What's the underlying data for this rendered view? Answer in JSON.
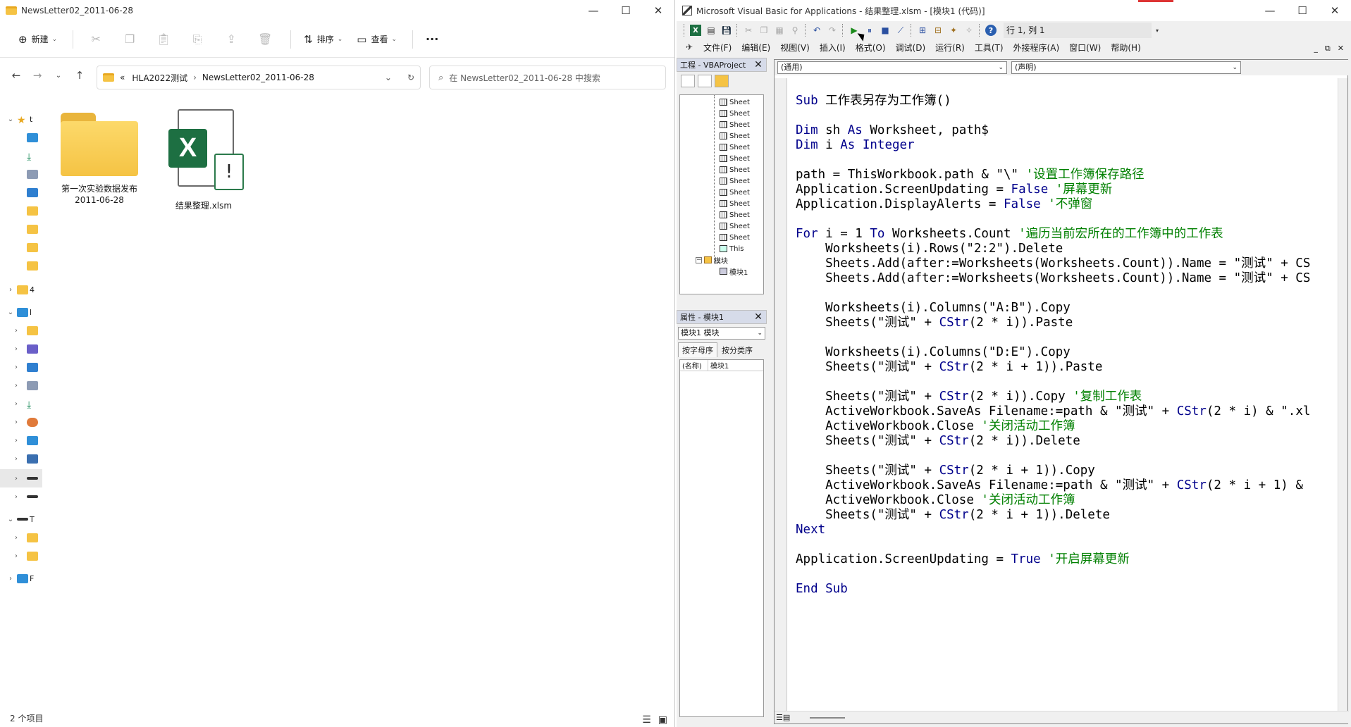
{
  "explorer": {
    "title": "NewsLetter02_2011-06-28",
    "toolbar": {
      "new_label": "新建",
      "sort_label": "排序",
      "view_label": "查看",
      "more_label": "···"
    },
    "address": {
      "prefix": "«",
      "crumbs": [
        "HLA2022测试",
        "NewsLetter02_2011-06-28"
      ]
    },
    "search_placeholder": "在 NewsLetter02_2011-06-28 中搜索",
    "files": [
      {
        "name_line1": "第一次实验数据发布",
        "name_line2": "2011-06-28",
        "type": "folder"
      },
      {
        "name_line1": "结果整理.xlsm",
        "name_line2": "",
        "type": "excel"
      }
    ],
    "status": "2 个项目",
    "sidebar_partial_labels": [
      "t",
      "4",
      "l",
      "T",
      "F"
    ]
  },
  "vba": {
    "title": "Microsoft Visual Basic for Applications - 结果整理.xlsm - [模块1 (代码)]",
    "position": "行 1, 列 1",
    "menus": [
      "文件(F)",
      "编辑(E)",
      "视图(V)",
      "插入(I)",
      "格式(O)",
      "调试(D)",
      "运行(R)",
      "工具(T)",
      "外接程序(A)",
      "窗口(W)",
      "帮助(H)"
    ],
    "project_panel_title": "工程 - VBAProject",
    "tree_sheet_label": "Sheet",
    "tree_this_label": "This",
    "tree_modules_folder": "模块",
    "tree_module1": "模块1",
    "properties_title": "属性 - 模块1",
    "properties_combo": "模块1 模块",
    "properties_tabs": [
      "按字母序",
      "按分类序"
    ],
    "properties_row": {
      "key": "(名称)",
      "value": "模块1"
    },
    "combo_left": "(通用)",
    "combo_right": "(声明)",
    "code": [
      [
        [
          "k",
          "Sub "
        ],
        [
          "n",
          "工作表另存为工作簿()"
        ]
      ],
      [],
      [
        [
          "k",
          "Dim "
        ],
        [
          "n",
          "sh "
        ],
        [
          "k",
          "As "
        ],
        [
          "n",
          "Worksheet, path$"
        ]
      ],
      [
        [
          "k",
          "Dim "
        ],
        [
          "n",
          "i "
        ],
        [
          "k",
          "As Integer"
        ]
      ],
      [],
      [
        [
          "n",
          "path = ThisWorkbook.path & \"\\\" "
        ],
        [
          "c",
          "'设置工作簿保存路径"
        ]
      ],
      [
        [
          "n",
          "Application.ScreenUpdating = "
        ],
        [
          "k",
          "False "
        ],
        [
          "c",
          "'屏幕更新"
        ]
      ],
      [
        [
          "n",
          "Application.DisplayAlerts = "
        ],
        [
          "k",
          "False "
        ],
        [
          "c",
          "'不弹窗"
        ]
      ],
      [],
      [
        [
          "k",
          "For "
        ],
        [
          "n",
          "i = 1 "
        ],
        [
          "k",
          "To "
        ],
        [
          "n",
          "Worksheets.Count "
        ],
        [
          "c",
          "'遍历当前宏所在的工作簿中的工作表"
        ]
      ],
      [
        [
          "n",
          "    Worksheets(i).Rows(\"2:2\").Delete"
        ]
      ],
      [
        [
          "n",
          "    Sheets.Add(after:=Worksheets(Worksheets.Count)).Name = \"测试\" + CS"
        ]
      ],
      [
        [
          "n",
          "    Sheets.Add(after:=Worksheets(Worksheets.Count)).Name = \"测试\" + CS"
        ]
      ],
      [],
      [
        [
          "n",
          "    Worksheets(i).Columns(\"A:B\").Copy"
        ]
      ],
      [
        [
          "n",
          "    Sheets(\"测试\" + "
        ],
        [
          "k",
          "CStr"
        ],
        [
          "n",
          "(2 * i)).Paste"
        ]
      ],
      [],
      [
        [
          "n",
          "    Worksheets(i).Columns(\"D:E\").Copy"
        ]
      ],
      [
        [
          "n",
          "    Sheets(\"测试\" + "
        ],
        [
          "k",
          "CStr"
        ],
        [
          "n",
          "(2 * i + 1)).Paste"
        ]
      ],
      [],
      [
        [
          "n",
          "    Sheets(\"测试\" + "
        ],
        [
          "k",
          "CStr"
        ],
        [
          "n",
          "(2 * i)).Copy "
        ],
        [
          "c",
          "'复制工作表"
        ]
      ],
      [
        [
          "n",
          "    ActiveWorkbook.SaveAs Filename:=path & \"测试\" + "
        ],
        [
          "k",
          "CStr"
        ],
        [
          "n",
          "(2 * i) & \".xl"
        ]
      ],
      [
        [
          "n",
          "    ActiveWorkbook.Close "
        ],
        [
          "c",
          "'关闭活动工作簿"
        ]
      ],
      [
        [
          "n",
          "    Sheets(\"测试\" + "
        ],
        [
          "k",
          "CStr"
        ],
        [
          "n",
          "(2 * i)).Delete"
        ]
      ],
      [],
      [
        [
          "n",
          "    Sheets(\"测试\" + "
        ],
        [
          "k",
          "CStr"
        ],
        [
          "n",
          "(2 * i + 1)).Copy"
        ]
      ],
      [
        [
          "n",
          "    ActiveWorkbook.SaveAs Filename:=path & \"测试\" + "
        ],
        [
          "k",
          "CStr"
        ],
        [
          "n",
          "(2 * i + 1) &"
        ]
      ],
      [
        [
          "n",
          "    ActiveWorkbook.Close "
        ],
        [
          "c",
          "'关闭活动工作簿"
        ]
      ],
      [
        [
          "n",
          "    Sheets(\"测试\" + "
        ],
        [
          "k",
          "CStr"
        ],
        [
          "n",
          "(2 * i + 1)).Delete"
        ]
      ],
      [
        [
          "k",
          "Next"
        ]
      ],
      [],
      [
        [
          "n",
          "Application.ScreenUpdating = "
        ],
        [
          "k",
          "True "
        ],
        [
          "c",
          "'开启屏幕更新"
        ]
      ],
      [],
      [
        [
          "k",
          "End Sub"
        ]
      ]
    ]
  }
}
